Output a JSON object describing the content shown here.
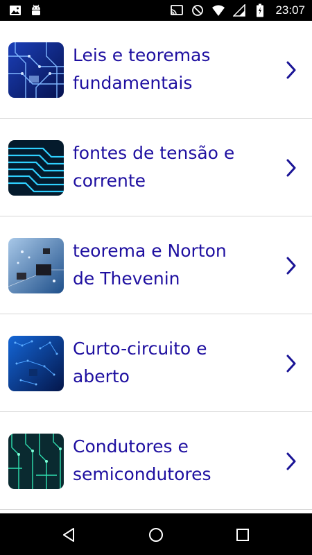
{
  "status_bar": {
    "time": "23:07",
    "left_icons": [
      "image-icon",
      "android-icon"
    ],
    "right_icons": [
      "cast-icon",
      "do-not-disturb-icon",
      "wifi-icon",
      "signal-icon",
      "battery-icon"
    ]
  },
  "topics": [
    {
      "line1": "Leis e teoremas",
      "line2": "fundamentais",
      "thumb": "circuit-board-blue"
    },
    {
      "line1": "fontes de tensão e",
      "line2": "corrente",
      "thumb": "circuit-traces-cyan"
    },
    {
      "line1": "teorema e Norton",
      "line2": "de Thevenin",
      "thumb": "circuit-chips"
    },
    {
      "line1": "Curto-circuito e",
      "line2": "aberto",
      "thumb": "circuit-board-dark-blue"
    },
    {
      "line1": "Condutores e",
      "line2": "semicondutores",
      "thumb": "circuit-board-green"
    }
  ],
  "nav_bar": {
    "buttons": [
      "back-icon",
      "home-icon",
      "recents-icon"
    ]
  },
  "colors": {
    "title_text": "#1e0fa0",
    "chevron": "#1a1496",
    "divider": "#d6d6d6"
  }
}
